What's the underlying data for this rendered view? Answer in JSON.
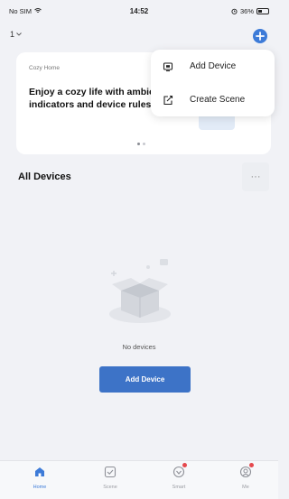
{
  "status_bar": {
    "carrier": "No SIM",
    "time": "14:52",
    "battery": "36%"
  },
  "header": {
    "home_selector": "1",
    "add_icon": "plus-circle-icon"
  },
  "banner": {
    "tag": "Cozy Home",
    "text": "Enjoy a cozy life with ambient indicators and device rules."
  },
  "menu": {
    "items": [
      {
        "label": "Add Device",
        "icon": "device-icon"
      },
      {
        "label": "Create Scene",
        "icon": "create-scene-icon"
      }
    ]
  },
  "section": {
    "title": "All Devices",
    "more": "···"
  },
  "empty_state": {
    "text": "No devices",
    "button": "Add Device"
  },
  "tabs": [
    {
      "label": "Home",
      "icon": "home-icon",
      "active": true
    },
    {
      "label": "Scene",
      "icon": "scene-icon",
      "active": false
    },
    {
      "label": "Smart",
      "icon": "smart-icon",
      "active": false,
      "badge": true
    },
    {
      "label": "Me",
      "icon": "me-icon",
      "active": false,
      "badge": true
    }
  ],
  "colors": {
    "accent": "#3d7bd8",
    "button": "#3d73c7",
    "background": "#f1f2f6",
    "badge": "#e5484d"
  }
}
